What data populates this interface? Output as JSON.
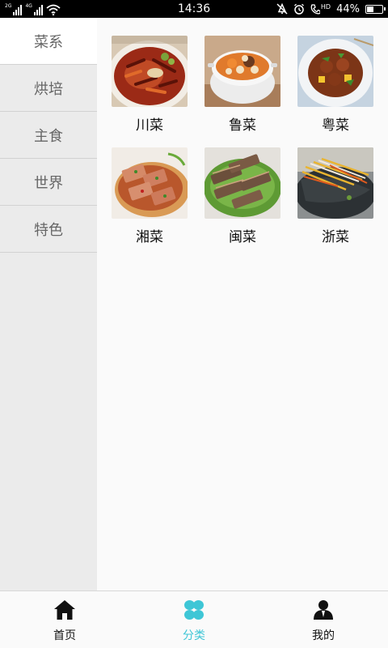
{
  "statusbar": {
    "network1": "2G",
    "network2": "4G",
    "time": "14:36",
    "battery_percent": "44%",
    "battery_level": 0.44,
    "volte": "HD"
  },
  "sidebar": {
    "items": [
      {
        "label": "菜系",
        "active": true
      },
      {
        "label": "烘培",
        "active": false
      },
      {
        "label": "主食",
        "active": false
      },
      {
        "label": "世界",
        "active": false
      },
      {
        "label": "特色",
        "active": false
      }
    ]
  },
  "dishes": [
    {
      "name": "川菜"
    },
    {
      "name": "鲁菜"
    },
    {
      "name": "粤菜"
    },
    {
      "name": "湘菜"
    },
    {
      "name": "闽菜"
    },
    {
      "name": "浙菜"
    }
  ],
  "bottomnav": {
    "items": [
      {
        "label": "首页",
        "icon": "home-icon"
      },
      {
        "label": "分类",
        "icon": "category-clover-icon",
        "active": true
      },
      {
        "label": "我的",
        "icon": "profile-icon"
      }
    ],
    "accent": "#3ec6d6"
  }
}
